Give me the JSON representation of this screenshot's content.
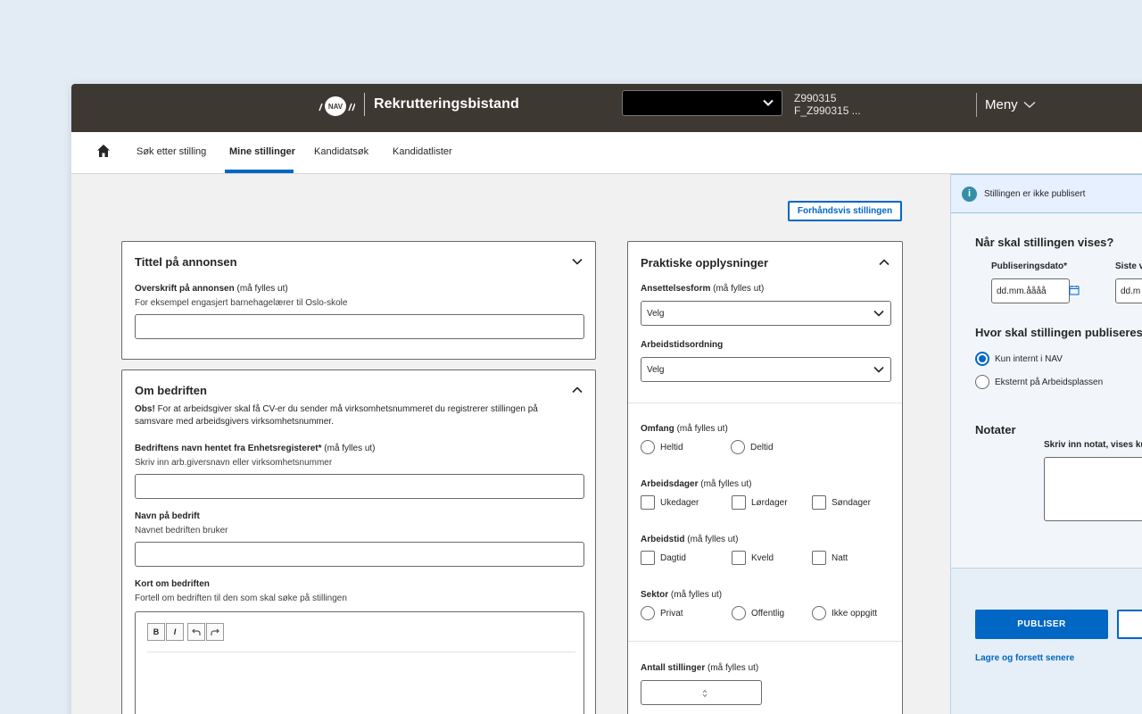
{
  "header": {
    "app_title": "Rekrutteringsbistand",
    "unit_select_value": "",
    "user_id": "Z990315",
    "user_name": "F_Z990315 ...",
    "menu_label": "Meny"
  },
  "nav": {
    "items": [
      {
        "label": "Søk etter stilling"
      },
      {
        "label": "Mine stillinger"
      },
      {
        "label": "Kandidatsøk"
      },
      {
        "label": "Kandidatlister"
      }
    ],
    "active_index": 1
  },
  "toolbar": {
    "preview_label": "Forhåndsvis stillingen"
  },
  "title_card": {
    "title": "Tittel på annonsen",
    "field_label": "Overskrift på annonsen",
    "field_hint": "(må fylles ut)",
    "field_desc": "For eksempel engasjert barnehagelærer til Oslo-skole",
    "field_value": ""
  },
  "company_card": {
    "title": "Om bedriften",
    "obs_label": "Obs!",
    "obs_text": "For at arbeidsgiver skal få CV-er du sender må virksomhetsnummeret du registrerer stillingen på samsvare med arbeidsgivers virksomhetsnummer.",
    "reg_name_label": "Bedriftens navn hentet fra Enhetsregisteret*",
    "reg_name_hint": "(må fylles ut)",
    "reg_name_desc": "Skriv inn arb.giversnavn eller virksomhetsnummer",
    "company_name_label": "Navn på bedrift",
    "company_name_desc": "Navnet bedriften bruker",
    "about_label": "Kort om bedriften",
    "about_desc": "Fortell om bedriften til den som skal søke på stillingen",
    "editor_bold": "B",
    "editor_italic": "I"
  },
  "practical_card": {
    "title": "Praktiske opplysninger",
    "employment_label": "Ansettelsesform",
    "required_hint": "(må fylles ut)",
    "employment_value": "Velg",
    "worktime_label": "Arbeidstidsordning",
    "worktime_value": "Velg",
    "scope_label": "Omfang",
    "scope_options": [
      "Heltid",
      "Deltid"
    ],
    "days_label": "Arbeidsdager",
    "days_options": [
      "Ukedager",
      "Lørdager",
      "Søndager"
    ],
    "hours_label": "Arbeidstid",
    "hours_options": [
      "Dagtid",
      "Kveld",
      "Natt"
    ],
    "sector_label": "Sektor",
    "sector_options": [
      "Privat",
      "Offentlig",
      "Ikke oppgitt"
    ],
    "positions_label": "Antall stillinger",
    "positions_value": ""
  },
  "side": {
    "alert": "Stillingen er ikke publisert",
    "when_heading": "Når skal stillingen vises?",
    "pub_date_label": "Publiseringsdato*",
    "pub_date_placeholder": "dd.mm.åååå",
    "last_date_label": "Siste v",
    "last_date_placeholder": "dd.m",
    "where_heading": "Hvor skal stillingen publiseres?",
    "where_options": [
      "Kun internt i NAV",
      "Eksternt på Arbeidsplassen"
    ],
    "where_selected": 0,
    "notes_heading": "Notater",
    "notes_label": "Skriv inn notat, vises ku",
    "publish_label": "PUBLISER",
    "save_later_label": "Lagre og forsett senere"
  },
  "colors": {
    "topbar": "#3e3832",
    "accent": "#0067c5",
    "info": "#368da8"
  }
}
